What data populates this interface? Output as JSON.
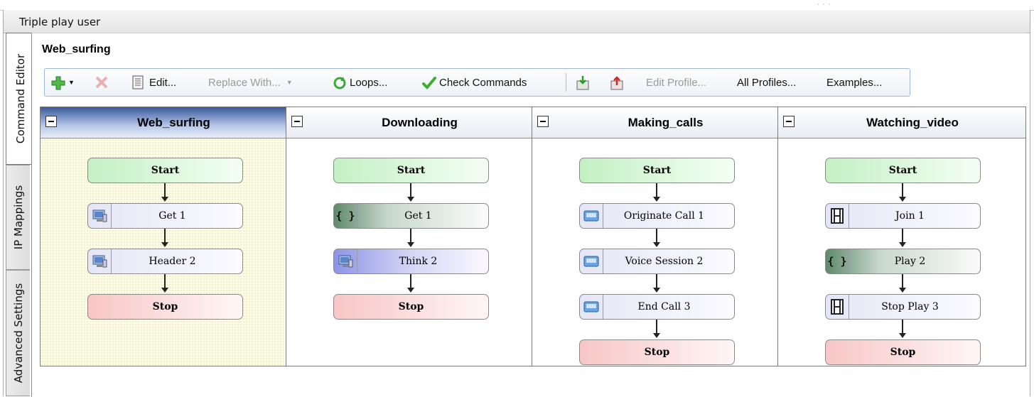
{
  "window": {
    "title": "Triple play user"
  },
  "side_tabs": [
    {
      "label": "Command Editor",
      "active": true
    },
    {
      "label": "IP Mappings",
      "active": false
    },
    {
      "label": "Advanced Settings",
      "active": false
    }
  ],
  "page_title": "Web_surfing",
  "toolbar": {
    "edit": "Edit...",
    "replace_with": "Replace With...",
    "loops": "Loops...",
    "check_commands": "Check Commands",
    "edit_profile": "Edit Profile...",
    "all_profiles": "All Profiles...",
    "examples": "Examples..."
  },
  "colors": {
    "start": "#c4f0c4",
    "stop": "#f8c6c6",
    "selected_header": "#3a5aa0"
  },
  "columns": [
    {
      "title": "Web_surfing",
      "selected": true,
      "nodes": [
        {
          "type": "start",
          "label": "Start"
        },
        {
          "type": "cmd",
          "label": "Get 1",
          "icon": "computer-icon"
        },
        {
          "type": "cmd",
          "label": "Header 2",
          "icon": "computer-icon"
        },
        {
          "type": "stop",
          "label": "Stop"
        }
      ]
    },
    {
      "title": "Downloading",
      "selected": false,
      "nodes": [
        {
          "type": "start",
          "label": "Start"
        },
        {
          "type": "cmd",
          "label": "Get 1",
          "icon": "braces-icon"
        },
        {
          "type": "cmd",
          "label": "Think 2",
          "icon": "computer-icon"
        },
        {
          "type": "stop",
          "label": "Stop"
        }
      ]
    },
    {
      "title": "Making_calls",
      "selected": false,
      "nodes": [
        {
          "type": "start",
          "label": "Start"
        },
        {
          "type": "cmd",
          "label": "Originate Call 1",
          "icon": "phone-icon"
        },
        {
          "type": "cmd",
          "label": "Voice Session 2",
          "icon": "phone-icon"
        },
        {
          "type": "cmd",
          "label": "End Call 3",
          "icon": "phone-icon"
        },
        {
          "type": "stop",
          "label": "Stop"
        }
      ]
    },
    {
      "title": "Watching_video",
      "selected": false,
      "nodes": [
        {
          "type": "start",
          "label": "Start"
        },
        {
          "type": "cmd",
          "label": "Join 1",
          "icon": "film-icon"
        },
        {
          "type": "cmd",
          "label": "Play 2",
          "icon": "braces-icon"
        },
        {
          "type": "cmd",
          "label": "Stop Play 3",
          "icon": "film-icon"
        },
        {
          "type": "stop",
          "label": "Stop"
        }
      ]
    }
  ]
}
